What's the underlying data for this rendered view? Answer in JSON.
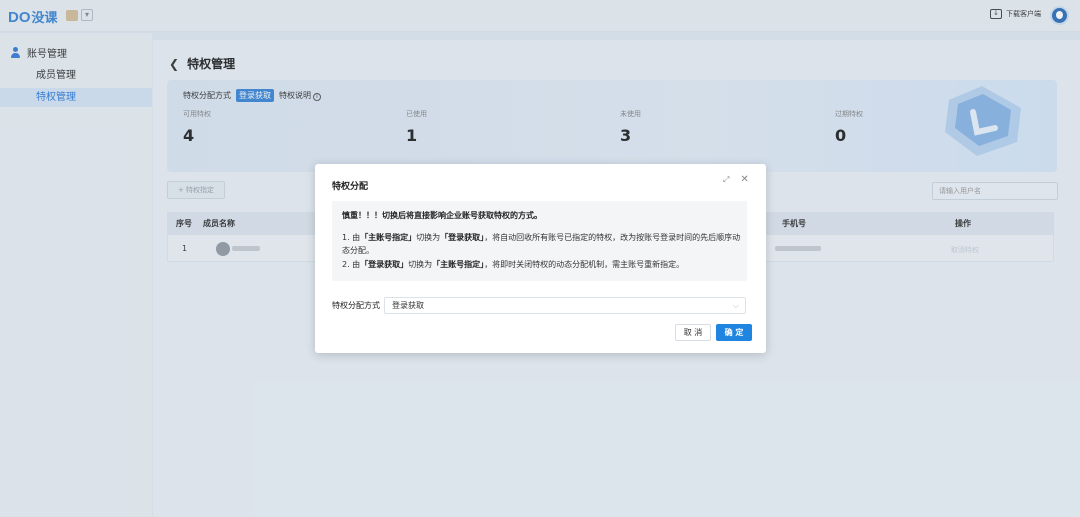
{
  "header": {
    "logo_latin": "DO",
    "logo_cn": "没课",
    "download_label": "下载客户端",
    "icons": {
      "download": "monitor-download-icon",
      "avatar": "user-avatar-icon",
      "team": "team-switch-icon"
    }
  },
  "sidebar": {
    "section_label": "账号管理",
    "items": [
      {
        "label": "成员管理",
        "active": false
      },
      {
        "label": "特权管理",
        "active": true
      }
    ]
  },
  "page": {
    "title": "特权管理",
    "mode_label": "特权分配方式",
    "mode_value": "登录获取",
    "mode_help": "特权说明",
    "stats": [
      {
        "label": "可用特权",
        "value": "4"
      },
      {
        "label": "已使用",
        "value": "1"
      },
      {
        "label": "未使用",
        "value": "3"
      },
      {
        "label": "过期特权",
        "value": "0"
      }
    ],
    "assign_button": "+ 特权指定",
    "search_placeholder": "请输入用户名",
    "table": {
      "headers": [
        "序号",
        "成员名称",
        "手机号",
        "操作"
      ],
      "rows": [
        {
          "index": "1",
          "action": "取消特权"
        }
      ]
    }
  },
  "modal": {
    "title": "特权分配",
    "warning_title": "慎重！！！切换后将直接影响企业账号获取特权的方式。",
    "line1_prefix": "1. 由",
    "line1_from": "「主账号指定」",
    "line1_mid": "切换为",
    "line1_to": "「登录获取」",
    "line1_suffix": "，将自动回收所有账号已指定的特权，改为按账号登录时间的先后顺序动态分配。",
    "line2_prefix": "2. 由",
    "line2_from": "「登录获取」",
    "line2_mid": "切换为",
    "line2_to": "「主账号指定」",
    "line2_suffix": "，将即时关闭特权的动态分配机制，需主账号重新指定。",
    "field_label": "特权分配方式",
    "field_value": "登录获取",
    "cancel_label": "取 消",
    "ok_label": "确 定"
  },
  "colors": {
    "accent": "#1f85e0",
    "sidebar_active": "#2f7bd9"
  }
}
